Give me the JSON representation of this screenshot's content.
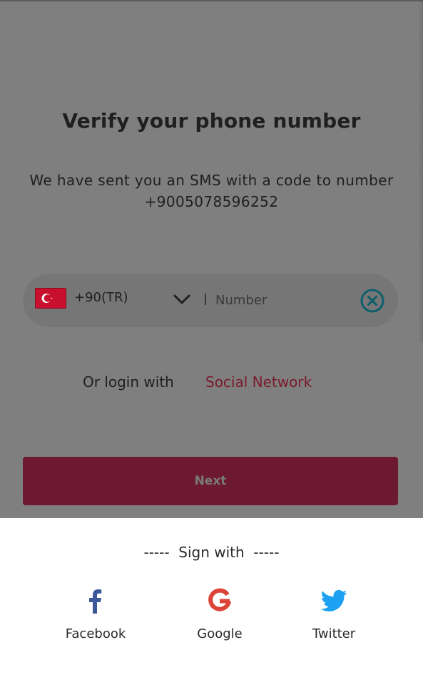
{
  "verify": {
    "title": "Verify your phone number",
    "message": "We have sent you an SMS with a code to number +9005078596252"
  },
  "phone": {
    "country_flag": "turkey-flag",
    "country_code": "+90(TR)",
    "placeholder": "Number",
    "value": ""
  },
  "login": {
    "prefix": "Or login with",
    "social_link": "Social Network"
  },
  "next_button": "Next",
  "sign_sheet": {
    "heading": "-----  Sign with  -----",
    "options": [
      {
        "label": "Facebook",
        "icon": "facebook-icon",
        "color": "#3b5998"
      },
      {
        "label": "Google",
        "icon": "google-icon",
        "color": "#db4437"
      },
      {
        "label": "Twitter",
        "icon": "twitter-icon",
        "color": "#1da1f2"
      }
    ]
  },
  "colors": {
    "accent": "#c01e4a",
    "overlay": "#7f7f7f",
    "clear_icon": "#0e5e6c"
  }
}
